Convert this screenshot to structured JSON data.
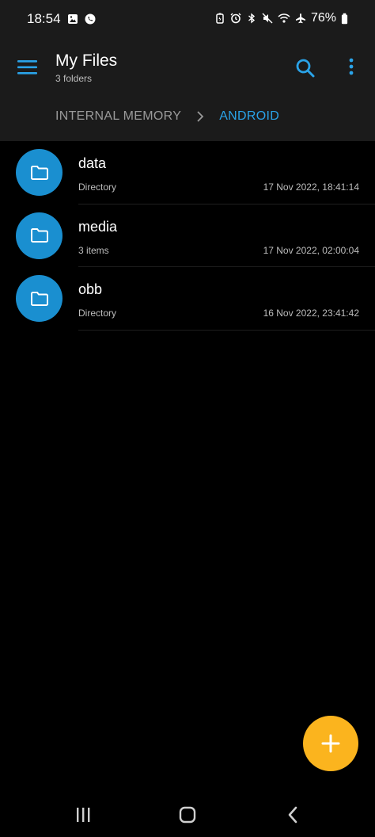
{
  "status_bar": {
    "time": "18:54",
    "battery": "76%",
    "icons_left": [
      "gallery-icon",
      "phone-icon"
    ],
    "icons_right": [
      "battery-saver-icon",
      "alarm-icon",
      "bluetooth-icon",
      "mute-icon",
      "wifi-icon",
      "airplane-icon",
      "battery-icon"
    ]
  },
  "appbar": {
    "title": "My Files",
    "subtitle": "3 folders"
  },
  "breadcrumb": {
    "items": [
      "INTERNAL MEMORY",
      "ANDROID"
    ],
    "active_color": "#2aa3e8"
  },
  "files": [
    {
      "name": "data",
      "meta": "Directory",
      "date": "17 Nov 2022, 18:41:14",
      "icon": "folder-icon"
    },
    {
      "name": "media",
      "meta": "3 items",
      "date": "17 Nov 2022, 02:00:04",
      "icon": "folder-icon"
    },
    {
      "name": "obb",
      "meta": "Directory",
      "date": "16 Nov 2022, 23:41:42",
      "icon": "folder-icon"
    }
  ],
  "colors": {
    "accent": "#1a8fd0",
    "fab": "#fbb41e",
    "background": "#000000",
    "appbar": "#1b1b1b"
  },
  "nav": {
    "icons": [
      "recents-icon",
      "home-icon",
      "back-icon"
    ]
  }
}
